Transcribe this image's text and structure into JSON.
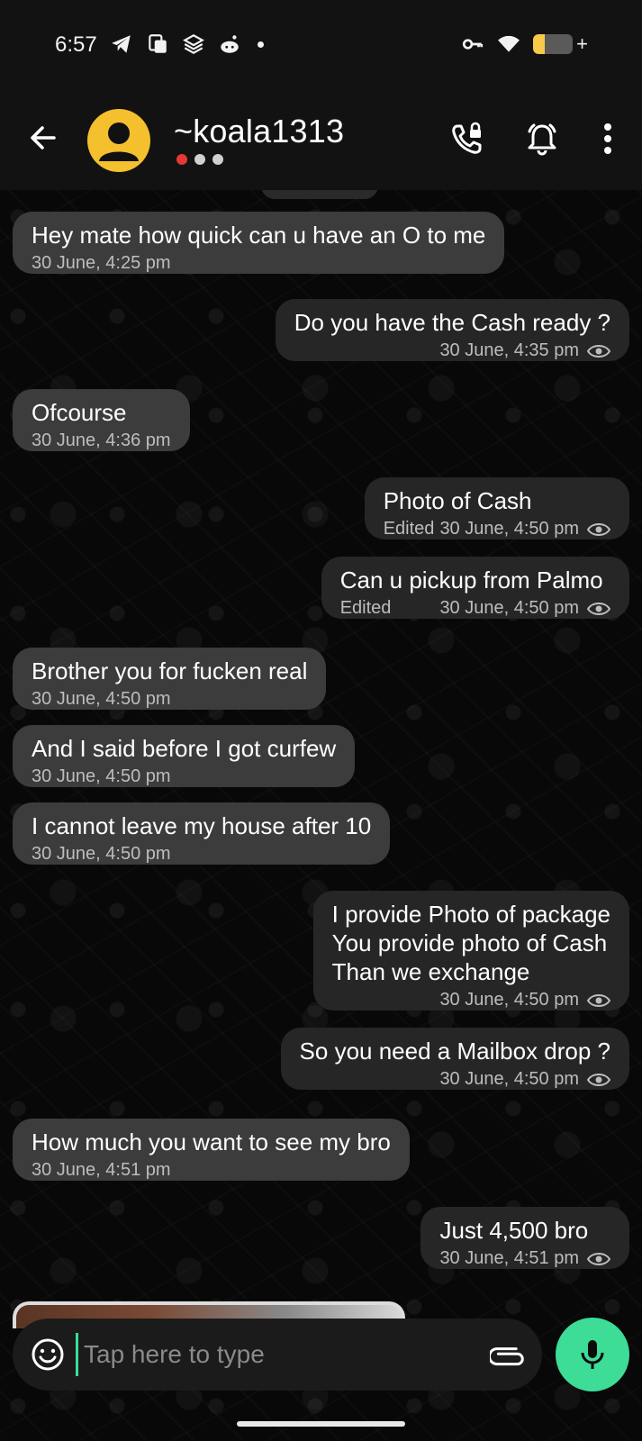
{
  "status_bar": {
    "time": "6:57",
    "left_icons": [
      "telegram-icon",
      "photos-icon",
      "stack-icon",
      "reddit-icon"
    ],
    "right_icons": [
      "vpn-key-icon",
      "wifi-icon",
      "battery-icon"
    ],
    "battery_level": 0.3,
    "battery_color": "#f7c948"
  },
  "header": {
    "contact_name": "~koala1313",
    "presence_dot_colors": [
      "#e53935",
      "#d0d0d0",
      "#d0d0d0"
    ],
    "avatar_color": "#f5c02e"
  },
  "messages": [
    {
      "dir": "in",
      "text": "Hey mate how quick can u have an O to me",
      "time": "30 June, 4:25 pm"
    },
    {
      "dir": "out",
      "text": "Do you have the Cash ready ?",
      "time": "30 June, 4:35 pm",
      "seen": true
    },
    {
      "dir": "in",
      "text": "Ofcourse",
      "time": "30 June, 4:36 pm"
    },
    {
      "dir": "out",
      "text": "Photo of Cash",
      "edited": "Edited",
      "time": "30 June, 4:50 pm",
      "seen": true
    },
    {
      "dir": "out",
      "text": "Can u pickup from Palmo",
      "edited": "Edited",
      "time": "30 June, 4:50 pm",
      "seen": true
    },
    {
      "dir": "in",
      "text": "Brother you for fucken real",
      "time": "30 June, 4:50 pm"
    },
    {
      "dir": "in",
      "text": "And I said before I got curfew",
      "time": "30 June, 4:50 pm"
    },
    {
      "dir": "in",
      "text": "I cannot leave my house after 10",
      "time": "30 June, 4:50 pm"
    },
    {
      "dir": "out",
      "text": "I provide Photo of package\nYou provide photo of Cash\nThan we exchange",
      "time": "30 June, 4:50 pm",
      "seen": true
    },
    {
      "dir": "out",
      "text": "So you need a Mailbox drop ?",
      "time": "30 June, 4:50 pm",
      "seen": true
    },
    {
      "dir": "in",
      "text": "How much you want to see my bro",
      "time": "30 June, 4:51 pm"
    },
    {
      "dir": "out",
      "text": "Just 4,500 bro",
      "time": "30 June, 4:51 pm",
      "seen": true
    }
  ],
  "composer": {
    "placeholder": "Tap here to type",
    "mic_color": "#3ddc97"
  }
}
